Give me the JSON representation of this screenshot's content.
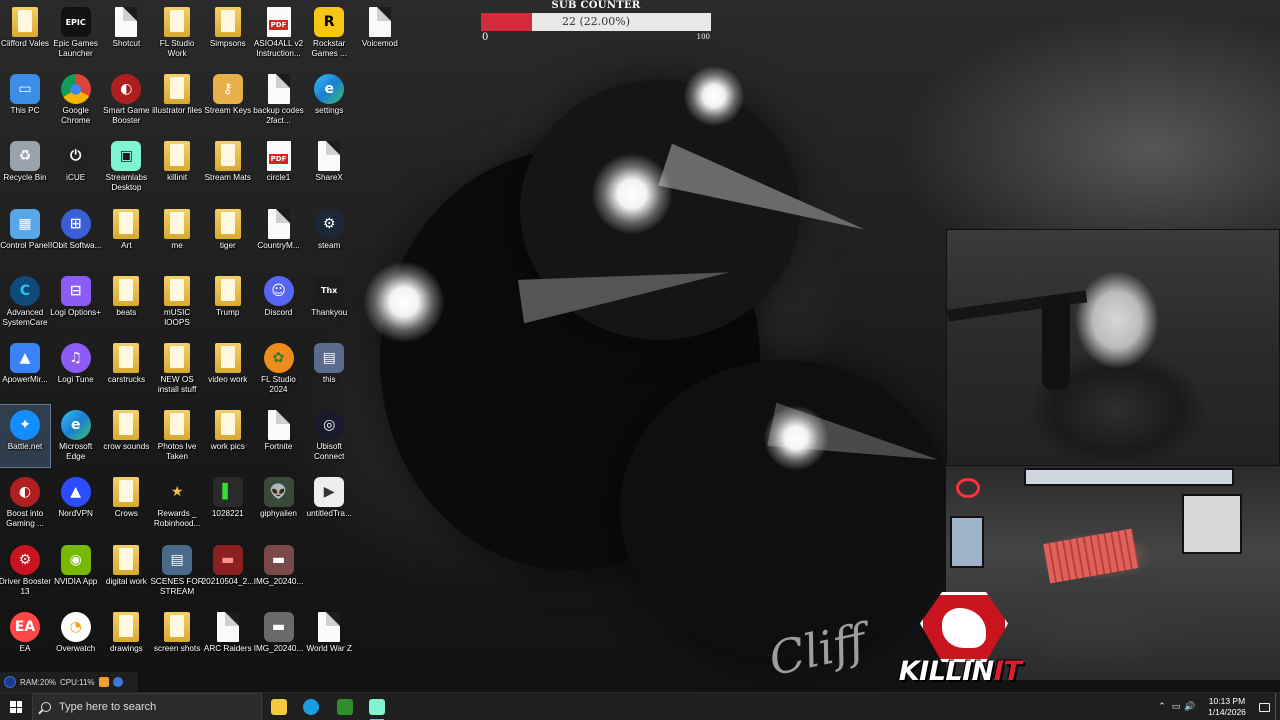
{
  "desktop_icons": [
    {
      "label": "Clifford Vales",
      "icon": "folder-person-icon",
      "kind": "folder"
    },
    {
      "label": "Epic Games Launcher",
      "icon": "epic-games-icon",
      "kind": "app",
      "bg": "#111111",
      "fg": "#ffffff",
      "glyph": "EPIC"
    },
    {
      "label": "Shotcut",
      "icon": "document-icon",
      "kind": "doc"
    },
    {
      "label": "FL Studio Work",
      "icon": "folder-icon",
      "kind": "folder"
    },
    {
      "label": "Simpsons",
      "icon": "folder-icon",
      "kind": "folder"
    },
    {
      "label": "ASIO4ALL v2 Instruction...",
      "icon": "pdf-icon",
      "kind": "pdf"
    },
    {
      "label": "Rockstar Games ...",
      "icon": "rockstar-icon",
      "kind": "app",
      "bg": "#f5c518",
      "fg": "#000000",
      "glyph": "R"
    },
    {
      "label": "Voicemod",
      "icon": "document-icon",
      "kind": "doc"
    },
    {
      "label": "This PC",
      "icon": "computer-icon",
      "kind": "app",
      "bg": "#3a8ee6",
      "fg": "#ffffff",
      "glyph": "▭"
    },
    {
      "label": "Google Chrome",
      "icon": "chrome-icon",
      "kind": "round",
      "bg": "conic-gradient(#db4437 0 33%, #f4b400 0 66%, #0f9d58 0)",
      "fg": "#4285f4",
      "glyph": "●"
    },
    {
      "label": "Smart Game Booster",
      "icon": "game-booster-icon",
      "kind": "round",
      "bg": "#b01f1f",
      "fg": "#ffffff",
      "glyph": "◐"
    },
    {
      "label": "illustrator files",
      "icon": "folder-icon",
      "kind": "folder"
    },
    {
      "label": "Stream Keys",
      "icon": "key-icon",
      "kind": "app",
      "bg": "#e8b04a",
      "fg": "#ffffff",
      "glyph": "⚷"
    },
    {
      "label": "backup codes 2fact...",
      "icon": "document-icon",
      "kind": "doc"
    },
    {
      "label": "settings",
      "icon": "edge-icon",
      "kind": "round",
      "bg": "linear-gradient(135deg,#35c1f1,#1b7ed6,#3ac46a)",
      "fg": "#ffffff",
      "glyph": "e"
    },
    {
      "label": "",
      "icon": "",
      "kind": "none"
    },
    {
      "label": "Recycle Bin",
      "icon": "recycle-bin-icon",
      "kind": "app",
      "bg": "#9aa3ad",
      "fg": "#ffffff",
      "glyph": "♻"
    },
    {
      "label": "iCUE",
      "icon": "icue-icon",
      "kind": "round",
      "bg": "#222222",
      "fg": "#ffffff",
      "glyph": "⏻"
    },
    {
      "label": "Streamlabs Desktop",
      "icon": "streamlabs-icon",
      "kind": "app",
      "bg": "#80f5d2",
      "fg": "#1a1a1a",
      "glyph": "▣"
    },
    {
      "label": "killinit",
      "icon": "folder-icon",
      "kind": "folder"
    },
    {
      "label": "Stream Mats",
      "icon": "folder-icon",
      "kind": "folder"
    },
    {
      "label": "circle1",
      "icon": "pdf-icon",
      "kind": "pdf"
    },
    {
      "label": "ShareX",
      "icon": "document-icon",
      "kind": "doc"
    },
    {
      "label": "",
      "icon": "",
      "kind": "none"
    },
    {
      "label": "Control Panel",
      "icon": "control-panel-icon",
      "kind": "app",
      "bg": "#5aa7e8",
      "fg": "#ffffff",
      "glyph": "▦"
    },
    {
      "label": "IObit Softwa...",
      "icon": "iobit-icon",
      "kind": "round",
      "bg": "#3b5fd6",
      "fg": "#ffffff",
      "glyph": "⊞"
    },
    {
      "label": "Art",
      "icon": "folder-icon",
      "kind": "folder"
    },
    {
      "label": "me",
      "icon": "folder-icon",
      "kind": "folder"
    },
    {
      "label": "tiger",
      "icon": "folder-icon",
      "kind": "folder"
    },
    {
      "label": "CountryM...",
      "icon": "document-icon",
      "kind": "doc"
    },
    {
      "label": "steam",
      "icon": "steam-icon",
      "kind": "round",
      "bg": "#1b2838",
      "fg": "#ffffff",
      "glyph": "⚙"
    },
    {
      "label": "",
      "icon": "",
      "kind": "none"
    },
    {
      "label": "Advanced SystemCare",
      "icon": "systemcare-icon",
      "kind": "round",
      "bg": "#0e4a7a",
      "fg": "#2fc3f5",
      "glyph": "C"
    },
    {
      "label": "Logi Options+",
      "icon": "logi-icon",
      "kind": "app",
      "bg": "#8b5cf6",
      "fg": "#ffffff",
      "glyph": "⊟"
    },
    {
      "label": "beats",
      "icon": "folder-icon",
      "kind": "folder"
    },
    {
      "label": "mUSIC lOOPS",
      "icon": "folder-icon",
      "kind": "folder"
    },
    {
      "label": "Trump",
      "icon": "folder-icon",
      "kind": "folder"
    },
    {
      "label": "Discord",
      "icon": "discord-icon",
      "kind": "round",
      "bg": "#5865f2",
      "fg": "#ffffff",
      "glyph": "☺"
    },
    {
      "label": "Thankyou",
      "icon": "image-icon",
      "kind": "app",
      "bg": "#1c1c1c",
      "fg": "#ffffff",
      "glyph": "Thx"
    },
    {
      "label": "",
      "icon": "",
      "kind": "none"
    },
    {
      "label": "ApowerMir...",
      "icon": "apowermirror-icon",
      "kind": "app",
      "bg": "#3b82f6",
      "fg": "#ffffff",
      "glyph": "▲"
    },
    {
      "label": "Logi Tune",
      "icon": "logi-tune-icon",
      "kind": "round",
      "bg": "#8b5cf6",
      "fg": "#ffffff",
      "glyph": "♫"
    },
    {
      "label": "carstrucks",
      "icon": "folder-icon",
      "kind": "folder"
    },
    {
      "label": "NEW OS install stuff",
      "icon": "folder-icon",
      "kind": "folder"
    },
    {
      "label": "video work",
      "icon": "folder-icon",
      "kind": "folder"
    },
    {
      "label": "FL Studio 2024",
      "icon": "fl-studio-icon",
      "kind": "round",
      "bg": "#f08c1d",
      "fg": "#2e7d32",
      "glyph": "✿"
    },
    {
      "label": "this",
      "icon": "image-icon",
      "kind": "app",
      "bg": "#5b6b8b",
      "fg": "#ffffff",
      "glyph": "▤"
    },
    {
      "label": "",
      "icon": "",
      "kind": "none"
    },
    {
      "label": "Battle.net",
      "icon": "battlenet-icon",
      "kind": "round",
      "bg": "#148eff",
      "fg": "#ffffff",
      "glyph": "✦",
      "selected": true
    },
    {
      "label": "Microsoft Edge",
      "icon": "edge-icon",
      "kind": "round",
      "bg": "linear-gradient(135deg,#35c1f1,#1b7ed6,#3ac46a)",
      "fg": "#ffffff",
      "glyph": "e"
    },
    {
      "label": "crow sounds",
      "icon": "folder-icon",
      "kind": "folder"
    },
    {
      "label": "Photos Ive Taken",
      "icon": "folder-icon",
      "kind": "folder"
    },
    {
      "label": "work pics",
      "icon": "folder-icon",
      "kind": "folder"
    },
    {
      "label": "Fortnite",
      "icon": "document-icon",
      "kind": "doc"
    },
    {
      "label": "Ubisoft Connect",
      "icon": "ubisoft-icon",
      "kind": "round",
      "bg": "#1a1a2e",
      "fg": "#ffffff",
      "glyph": "◎"
    },
    {
      "label": "",
      "icon": "",
      "kind": "none"
    },
    {
      "label": "Boost into Gaming ...",
      "icon": "boost-icon",
      "kind": "round",
      "bg": "#b01f1f",
      "fg": "#ffffff",
      "glyph": "◐"
    },
    {
      "label": "NordVPN",
      "icon": "nordvpn-icon",
      "kind": "round",
      "bg": "#2b4cff",
      "fg": "#ffffff",
      "glyph": "▲"
    },
    {
      "label": "Crows",
      "icon": "folder-icon",
      "kind": "folder"
    },
    {
      "label": "Rewards _ Robinhood...",
      "icon": "star-icon",
      "kind": "app",
      "bg": "transparent",
      "fg": "#f5c542",
      "glyph": "★"
    },
    {
      "label": "1028221",
      "icon": "image-icon",
      "kind": "app",
      "bg": "#2a2a2a",
      "fg": "#35e035",
      "glyph": "▌"
    },
    {
      "label": "giphyalien",
      "icon": "image-icon",
      "kind": "app",
      "bg": "#3a4a3a",
      "fg": "#a0d0a0",
      "glyph": "👽"
    },
    {
      "label": "untitledTra...",
      "icon": "media-icon",
      "kind": "app",
      "bg": "#eeeeee",
      "fg": "#333333",
      "glyph": "▶"
    },
    {
      "label": "",
      "icon": "",
      "kind": "none"
    },
    {
      "label": "Driver Booster 13",
      "icon": "driver-booster-icon",
      "kind": "round",
      "bg": "#c9141f",
      "fg": "#ffffff",
      "glyph": "⚙"
    },
    {
      "label": "NVIDIA App",
      "icon": "nvidia-icon",
      "kind": "app",
      "bg": "#76b900",
      "fg": "#ffffff",
      "glyph": "◉"
    },
    {
      "label": "digital work",
      "icon": "folder-icon",
      "kind": "folder"
    },
    {
      "label": "SCENES FOR STREAM",
      "icon": "archive-icon",
      "kind": "app",
      "bg": "#4a6a8a",
      "fg": "#ffffff",
      "glyph": "▤"
    },
    {
      "label": "20210504_2...",
      "icon": "image-icon",
      "kind": "app",
      "bg": "#8a2020",
      "fg": "#ff9090",
      "glyph": "▬"
    },
    {
      "label": "IMG_20240...",
      "icon": "image-icon",
      "kind": "app",
      "bg": "#7a4a4a",
      "fg": "#ffffff",
      "glyph": "▬"
    },
    {
      "label": "",
      "icon": "",
      "kind": "none"
    },
    {
      "label": "",
      "icon": "",
      "kind": "none"
    },
    {
      "label": "EA",
      "icon": "ea-icon",
      "kind": "round",
      "bg": "#ff4747",
      "fg": "#ffffff",
      "glyph": "EA"
    },
    {
      "label": "Overwatch",
      "icon": "overwatch-icon",
      "kind": "round",
      "bg": "#ffffff",
      "fg": "#f99e1a",
      "glyph": "◔"
    },
    {
      "label": "drawings",
      "icon": "folder-icon",
      "kind": "folder"
    },
    {
      "label": "screen shots",
      "icon": "folder-icon",
      "kind": "folder"
    },
    {
      "label": "ARC Raiders",
      "icon": "document-icon",
      "kind": "doc"
    },
    {
      "label": "IMG_20240...",
      "icon": "image-icon",
      "kind": "app",
      "bg": "#6a6a6a",
      "fg": "#ffffff",
      "glyph": "▬"
    },
    {
      "label": "World War Z",
      "icon": "document-icon",
      "kind": "doc"
    },
    {
      "label": "",
      "icon": "",
      "kind": "none"
    }
  ],
  "sub_counter": {
    "title": "SUB COUNTER",
    "value_text": "22 (22.00%)",
    "progress": 0.22,
    "min": "0",
    "max": "100",
    "fill_color": "#d42b3a"
  },
  "logo": {
    "text_main": "KILLIN",
    "text_accent": "IT"
  },
  "signature": {
    "text": "Cliff"
  },
  "sysmon": {
    "ram": "RAM:20%",
    "cpu": "CPU:11%"
  },
  "taskbar": {
    "search_placeholder": "Type here to search",
    "apps": [
      {
        "name": "file-explorer-icon",
        "bg": "#f5c842"
      },
      {
        "name": "edge-icon",
        "bg": "#1b9de2"
      },
      {
        "name": "xbox-icon",
        "bg": "#2f8f2f"
      },
      {
        "name": "streamlabs-icon",
        "bg": "#80f5d2"
      }
    ],
    "time": "10:13 PM",
    "date": "1/14/2026"
  },
  "tray_glyphs": {
    "chevron": "⌃",
    "network": "▭",
    "volume": "🔊"
  }
}
